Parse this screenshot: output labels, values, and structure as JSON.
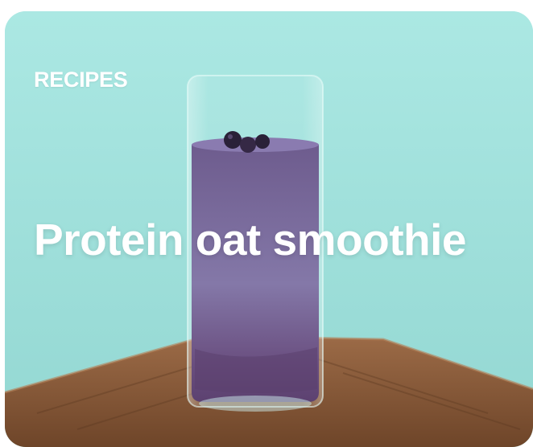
{
  "card": {
    "category": "RECIPES",
    "title": "Protein oat smoothie"
  },
  "image": {
    "subject": "smoothie-glass-photo"
  },
  "colors": {
    "background": "#a2e2dd",
    "smoothie": "#7c6a9e",
    "board": "#8a5a3a",
    "text": "#ffffff"
  }
}
